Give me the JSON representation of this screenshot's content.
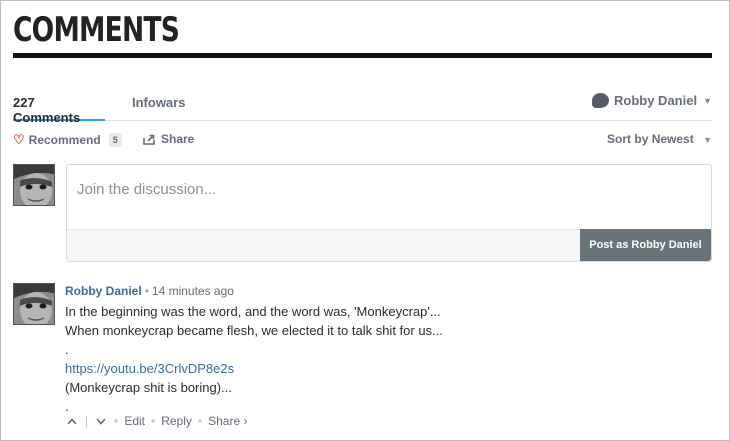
{
  "heading": "COMMENTS",
  "tabs": {
    "count": "227 Comments",
    "site": "Infowars"
  },
  "user_menu": {
    "name": "Robby Daniel"
  },
  "actions": {
    "recommend_label": "Recommend",
    "recommend_count": "5",
    "share_label": "Share",
    "sort_label": "Sort by Newest"
  },
  "composer": {
    "placeholder": "Join the discussion...",
    "post_label": "Post as Robby Daniel"
  },
  "comment": {
    "author": "Robby Daniel",
    "separator": "•",
    "time": "14 minutes ago",
    "lines": [
      "In the beginning was the word, and the word was, 'Monkeycrap'...",
      "When monkeycrap became flesh, we elected it to talk shit for us...",
      ".",
      "https://youtu.be/3CrlvDP8e2s",
      "(Monkeycrap shit is boring)...",
      "."
    ],
    "actions": {
      "edit": "Edit",
      "reply": "Reply",
      "share": "Share ›"
    }
  },
  "colors": {
    "accent_tab": "#2e9fff",
    "link": "#3c6aa8",
    "post_button": "#69737a",
    "heart": "#e94e4e"
  },
  "icons": [
    "heart-icon",
    "share-icon",
    "chat-bubble-icon",
    "caret-down-icon",
    "upvote-icon",
    "downvote-icon"
  ]
}
